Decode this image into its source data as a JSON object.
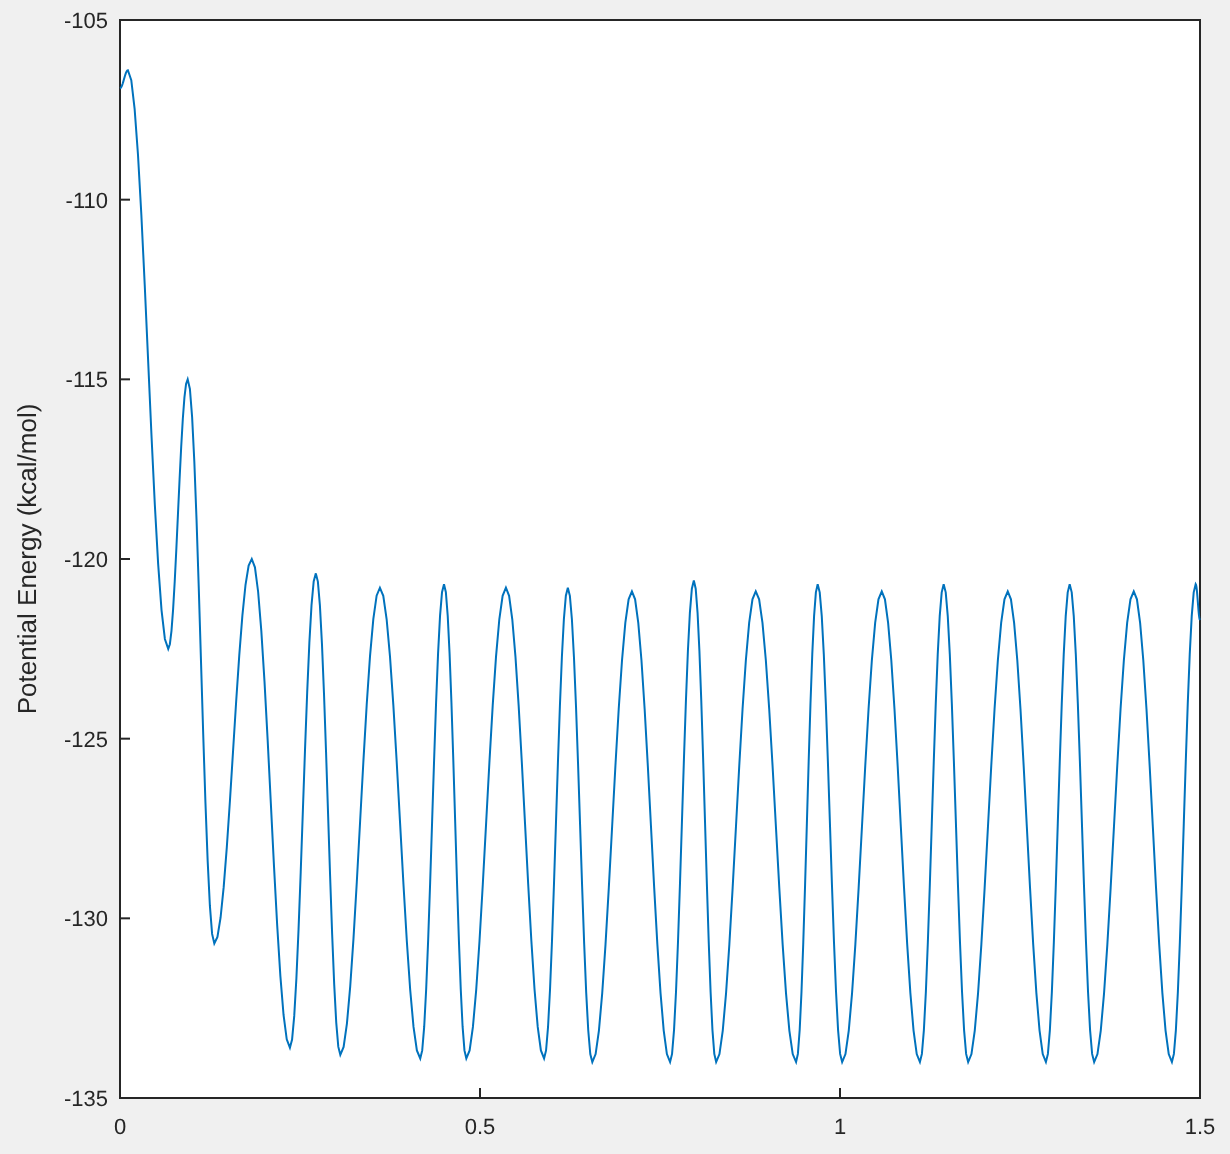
{
  "chart_data": {
    "type": "line",
    "ylabel": "Potential Energy (kcal/mol)",
    "xlim": [
      0,
      1.5
    ],
    "ylim": [
      -135,
      -105
    ],
    "xticks": [
      0,
      {
        "value": 0.5,
        "label": "0.5"
      },
      1,
      {
        "value": 1.5,
        "label": "1.5"
      }
    ],
    "yticks": [
      -135,
      -130,
      -125,
      -120,
      -115,
      -110,
      -105
    ],
    "x": [
      0,
      0.011,
      0.067,
      0.094,
      0.131,
      0.183,
      0.236,
      0.272,
      0.306,
      0.361,
      0.417,
      0.45,
      0.481,
      0.536,
      0.589,
      0.622,
      0.656,
      0.711,
      0.764,
      0.797,
      0.828,
      0.883,
      0.939,
      0.969,
      1.003,
      1.058,
      1.111,
      1.144,
      1.178,
      1.233,
      1.286,
      1.319,
      1.353,
      1.408,
      1.461,
      1.494,
      1.5
    ],
    "series": [
      {
        "color": "#0072bd",
        "values": [
          -106.9,
          -106.4,
          -122.5,
          -115.0,
          -130.7,
          -120.0,
          -133.6,
          -120.4,
          -133.8,
          -120.8,
          -133.9,
          -120.7,
          -133.9,
          -120.8,
          -133.9,
          -120.8,
          -134.0,
          -120.9,
          -134.0,
          -120.6,
          -134.0,
          -120.9,
          -134.0,
          -120.7,
          -134.0,
          -120.9,
          -134.0,
          -120.7,
          -134.0,
          -120.9,
          -134.0,
          -120.7,
          -134.0,
          -120.9,
          -134.0,
          -120.7,
          -121.7
        ]
      }
    ]
  }
}
